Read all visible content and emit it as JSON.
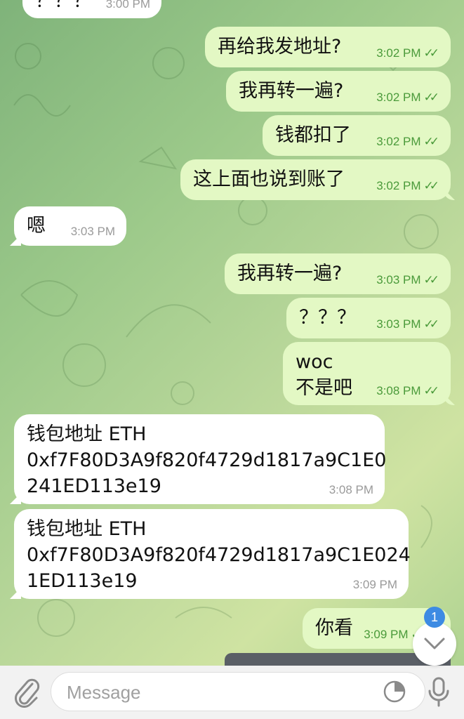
{
  "messages": [
    {
      "dir": "in",
      "text": "？？？",
      "time": "3:00 PM"
    },
    {
      "dir": "out",
      "text": "再给我发地址?",
      "time": "3:02 PM"
    },
    {
      "dir": "out",
      "text": "我再转一遍?",
      "time": "3:02 PM"
    },
    {
      "dir": "out",
      "text": "钱都扣了",
      "time": "3:02 PM"
    },
    {
      "dir": "out",
      "text": "这上面也说到账了",
      "time": "3:02 PM"
    },
    {
      "dir": "in",
      "text": "嗯",
      "time": "3:03 PM"
    },
    {
      "dir": "out",
      "text": "我再转一遍?",
      "time": "3:03 PM"
    },
    {
      "dir": "out",
      "text": "？？？",
      "time": "3:03 PM"
    },
    {
      "dir": "out",
      "lines": [
        "woc",
        "不是吧"
      ],
      "time": "3:08 PM"
    },
    {
      "dir": "in",
      "lines": [
        "钱包地址 ETH",
        "0xf7F80D3A9f820f4729d1817a9C1E0",
        "241ED113e19"
      ],
      "time": "3:08 PM"
    },
    {
      "dir": "in",
      "lines": [
        "钱包地址 ETH",
        "0xf7F80D3A9f820f4729d1817a9C1E024",
        "1ED113e19"
      ],
      "time": "3:09 PM"
    },
    {
      "dir": "out",
      "text": "你看",
      "time": "3:09 PM"
    }
  ],
  "unread_badge": "1",
  "composer": {
    "placeholder": "Message"
  },
  "icons": {
    "attach": "paperclip-icon",
    "sticker": "sticker-icon",
    "mic": "microphone-icon",
    "scroll": "chevron-down-icon",
    "read": "double-check-icon"
  },
  "colors": {
    "outgoing_bubble": "#e3f8c4",
    "incoming_bubble": "#ffffff",
    "time_out": "#4a9a3a",
    "badge": "#3d8be3"
  }
}
